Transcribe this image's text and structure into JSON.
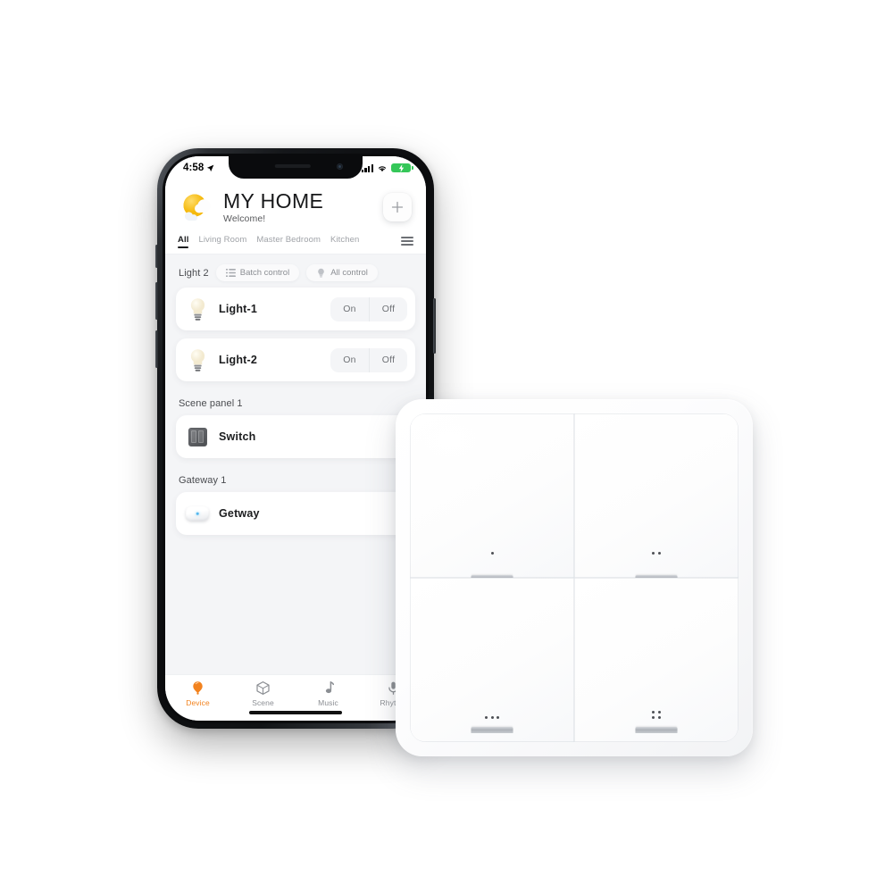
{
  "phone": {
    "status_bar": {
      "time": "4:58",
      "location_icon": "location-arrow-icon",
      "signal_icon": "cellular-signal-icon",
      "wifi_icon": "wifi-icon",
      "battery_icon": "battery-charging-icon"
    },
    "header": {
      "weather_icon": "sun-cloud-icon",
      "title": "MY HOME",
      "subtitle": "Welcome!",
      "add_label": "+",
      "add_icon": "plus-icon"
    },
    "room_tabs": [
      {
        "label": "All",
        "active": true
      },
      {
        "label": "Living Room",
        "active": false
      },
      {
        "label": "Master Bedroom",
        "active": false
      },
      {
        "label": "Kitchen",
        "active": false
      }
    ],
    "menu_icon": "hamburger-menu-icon",
    "light_group": {
      "name": "Light 2",
      "batch_control": {
        "label": "Batch control",
        "icon": "list-icon"
      },
      "all_control": {
        "label": "All control",
        "icon": "bulb-icon"
      }
    },
    "devices": [
      {
        "name": "Light-1",
        "icon": "light-bulb-icon",
        "on_label": "On",
        "off_label": "Off"
      },
      {
        "name": "Light-2",
        "icon": "light-bulb-icon",
        "on_label": "On",
        "off_label": "Off"
      }
    ],
    "sections": [
      {
        "label": "Scene panel 1",
        "item": {
          "name": "Switch",
          "icon": "switch-panel-icon"
        }
      },
      {
        "label": "Gateway 1",
        "item": {
          "name": "Getway",
          "icon": "gateway-icon"
        }
      }
    ],
    "tabbar": [
      {
        "label": "Device",
        "icon": "balloon-bulb-icon",
        "active": true
      },
      {
        "label": "Scene",
        "icon": "cube-icon",
        "active": false
      },
      {
        "label": "Music",
        "icon": "music-note-icon",
        "active": false
      },
      {
        "label": "Rhythm",
        "icon": "microphone-icon",
        "active": false
      }
    ],
    "accent_color": "#f2821e"
  },
  "wall_switch": {
    "name": "4-gang scene switch panel",
    "body_color": "#ffffff",
    "keys": [
      {
        "position": "top-left",
        "dots": 1
      },
      {
        "position": "top-right",
        "dots": 2
      },
      {
        "position": "bottom-left",
        "dots": 3
      },
      {
        "position": "bottom-right",
        "dots": 4
      }
    ]
  }
}
